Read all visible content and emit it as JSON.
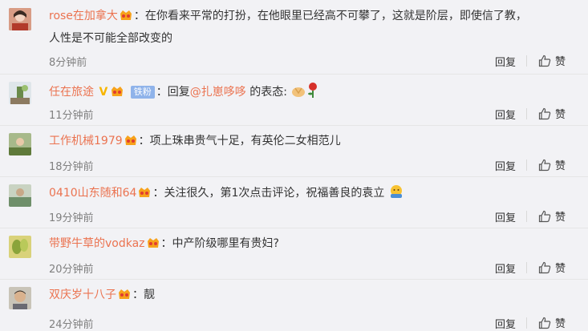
{
  "comments": [
    {
      "user": "rose在加拿大",
      "body": "在你看来平常的打扮，在他眼里已经高不可攀了，这就是阶层，即使信了教，",
      "body2": "人性是不可能全部改变的",
      "time": "8分钟前",
      "avatar_color": "#c9775c"
    },
    {
      "user": "任在旅途",
      "v_badge": "V",
      "fan_badge": "铁粉",
      "reply_prefix": "回复",
      "mention": "@扎崽哆哆",
      "body": "的表态:",
      "time": "11分钟前",
      "avatar_color": "#8aa3b6"
    },
    {
      "user": "工作机械1979",
      "body": "项上珠串贵气十足，有英伦二女相范儿",
      "time": "18分钟前",
      "avatar_color": "#8c9d62"
    },
    {
      "user": "0410山东随和64",
      "body": "关注很久，第1次点击评论，祝福善良的袁立",
      "time": "19分钟前",
      "avatar_color": "#7f9a86"
    },
    {
      "user": "带野牛草的vodkaz",
      "body": "中产阶级哪里有贵妇?",
      "time": "20分钟前",
      "avatar_color": "#9fae5a"
    },
    {
      "user": "双庆岁十八子",
      "body": "靓",
      "time": "24分钟前",
      "avatar_color": "#b8b4a8"
    }
  ],
  "actions": {
    "reply": "回复",
    "like": "赞"
  },
  "colors": {
    "username": "#eb7350",
    "time": "#808080",
    "vip": "#f7a21b"
  }
}
